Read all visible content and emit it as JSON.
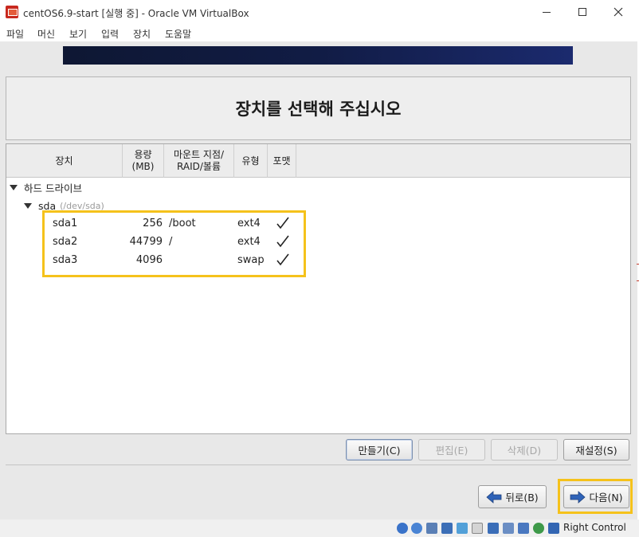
{
  "window": {
    "title": "centOS6.9-start [실행 중] - Oracle VM VirtualBox",
    "app_icon": "virtualbox-icon"
  },
  "menu": [
    "파일",
    "머신",
    "보기",
    "입력",
    "장치",
    "도움말"
  ],
  "installer": {
    "heading": "장치를 선택해 주십시오",
    "columns": {
      "device": "장치",
      "size": "용량\n(MB)",
      "mount": "마운트 지점/\nRAID/볼륨",
      "type": "유형",
      "format": "포맷"
    },
    "tree": {
      "group_label": "하드 드라이브",
      "disk_name": "sda",
      "disk_path": "(/dev/sda)",
      "partitions": [
        {
          "name": "sda1",
          "size": "256",
          "mount": "/boot",
          "type": "ext4",
          "format": true
        },
        {
          "name": "sda2",
          "size": "44799",
          "mount": "/",
          "type": "ext4",
          "format": true
        },
        {
          "name": "sda3",
          "size": "4096",
          "mount": "",
          "type": "swap",
          "format": true
        }
      ]
    },
    "buttons": {
      "create": "만들기(C)",
      "edit": "편집(E)",
      "delete": "삭제(D)",
      "reset": "재설정(S)",
      "back": "뒤로(B)",
      "next": "다음(N)"
    }
  },
  "statusbar": {
    "host_key": "Right Control"
  },
  "colors": {
    "highlight": "#f5c21b",
    "banner": "#111c45"
  }
}
